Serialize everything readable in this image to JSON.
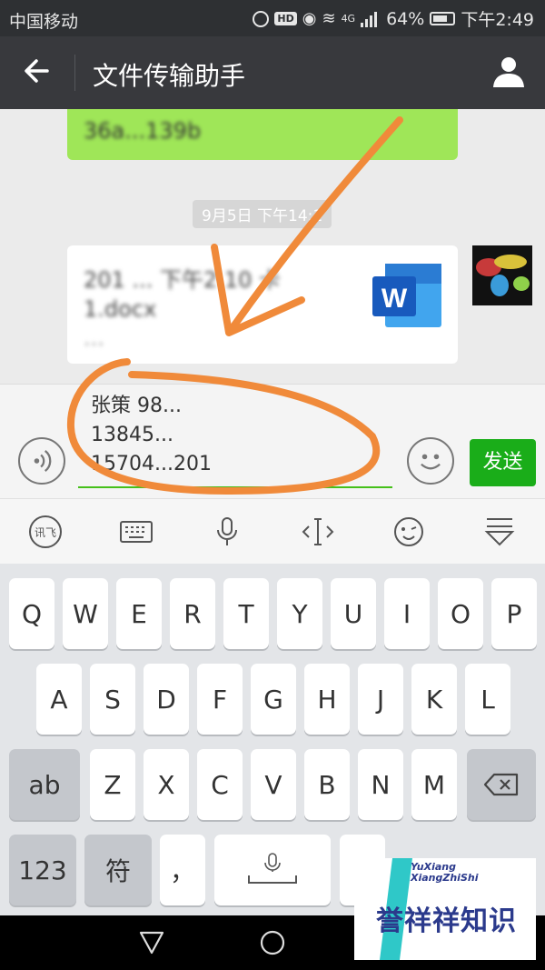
{
  "status": {
    "carrier": "中国移动",
    "hd": "HD",
    "network": "4G",
    "battery": "64%",
    "battery_level": 0.64,
    "time": "下午2:49"
  },
  "header": {
    "title": "文件传输助手"
  },
  "chat": {
    "green_message": "36a...139b",
    "timestamp": "9月5日 下午14:1",
    "file": {
      "line1": "201 ... 下午2 10 卡",
      "line2": "1.docx",
      "line3": "..."
    },
    "file_icon": "W"
  },
  "input": {
    "line1": "张策 98... ",
    "line2": "13845... ",
    "line3": "15704...201",
    "send_label": "发送"
  },
  "ime_toolbar": {
    "xunfei": "讯飞"
  },
  "keyboard": {
    "row1": [
      "Q",
      "W",
      "E",
      "R",
      "T",
      "Y",
      "U",
      "I",
      "O",
      "P"
    ],
    "row2": [
      "A",
      "S",
      "D",
      "F",
      "G",
      "H",
      "J",
      "K",
      "L"
    ],
    "row3": [
      "Z",
      "X",
      "C",
      "V",
      "B",
      "N",
      "M"
    ],
    "shift": "ab",
    "num": "123",
    "sym": "符",
    "comma": "，"
  },
  "watermark": {
    "line1": "YuXiang",
    "line2": "XiangZhiShi",
    "big": "誉祥祥知识"
  },
  "colors": {
    "accent_green": "#1aad19",
    "annotation": "#f08a3a",
    "bubble_green": "#9fe658"
  }
}
